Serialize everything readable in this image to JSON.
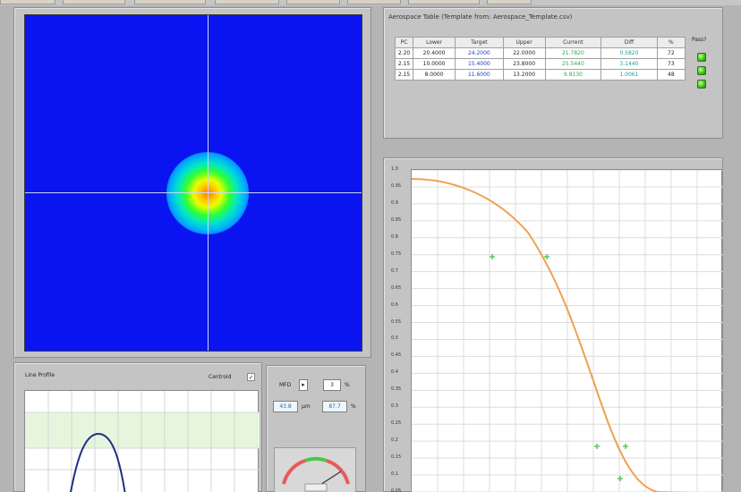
{
  "table": {
    "title": "Aerospace Table (Template from: Aerospace_Template.csv)",
    "headers": [
      "PC",
      "Lower",
      "Target",
      "Upper",
      "Current",
      "Diff",
      "%"
    ],
    "rows": [
      [
        "2.20",
        "20.4000",
        "24.2000",
        "22.0000",
        "21.7820",
        "0.5820",
        "72"
      ],
      [
        "2.15",
        "10.0000",
        "15.4000",
        "23.8000",
        "25.5440",
        "3.1440",
        "73"
      ],
      [
        "2.15",
        "8.0000",
        "11.6000",
        "13.2000",
        "9.8130",
        "1.0061",
        "48"
      ]
    ],
    "pass_label": "Pass?"
  },
  "chart_right": {
    "y_ticks": [
      "1.0",
      "0.95",
      "0.9",
      "0.85",
      "0.8",
      "0.75",
      "0.7",
      "0.65",
      "0.6",
      "0.55",
      "0.5",
      "0.45",
      "0.4",
      "0.35",
      "0.3",
      "0.25",
      "0.2",
      "0.15",
      "0.1",
      "0.05"
    ]
  },
  "line_profile": {
    "title": "Line Profile",
    "centroid_label": "Centroid",
    "centroid_check": "✓"
  },
  "controls": {
    "label": "MFD",
    "percent_value": "3",
    "percent_unit": "%",
    "value_a": "43.8",
    "unit_a": "µm",
    "value_b": "87.7",
    "unit_b": "%"
  },
  "chart_data": {
    "type": "line",
    "y_ticks": [
      1.0,
      0.95,
      0.9,
      0.85,
      0.8,
      0.75,
      0.7,
      0.65,
      0.6,
      0.55,
      0.5,
      0.45,
      0.4,
      0.35,
      0.3,
      0.25,
      0.2,
      0.15,
      0.1,
      0.05
    ],
    "ylim": [
      0.05,
      1.0
    ],
    "grid": true,
    "line_color": "#f0a050",
    "marker_color": "#5ac85a"
  }
}
